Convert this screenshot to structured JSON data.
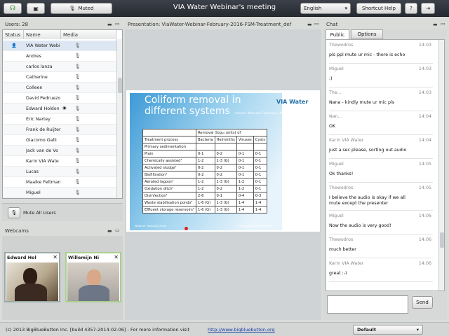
{
  "toolbar": {
    "muted_label": "Muted",
    "meeting_title": "VIA Water Webinar's meeting",
    "language": "English",
    "shortcut_label": "Shortcut Help"
  },
  "users": {
    "title": "Users: 28",
    "headers": [
      "Status",
      "Name",
      "Media"
    ],
    "rows": [
      "VIA Water Webi",
      "Andres",
      "carlos lanza",
      "Catherine",
      "Colleen",
      "David Pedruezo",
      "Edward Holdon",
      "Eric Nartey",
      "Frank de Ruijter",
      "Giacomo Galli",
      "Jack van de Vo",
      "Karin VIA Wate",
      "Lucas",
      "Maaike Feltman",
      "Miguel"
    ],
    "mute_all_label": "Mute All Users"
  },
  "presentation": {
    "title": "Presentation: ViaWater-Webinar-February-2016-FSM-Treatment_def",
    "slide_title_1": "Coliform removal in",
    "slide_title_2": "different systems",
    "slide_source": "(source: Mara and Cairncross, 1997)",
    "logo": "VIA Water",
    "table_header_top": "Removal (log₁₀ units) of",
    "table_header": [
      "Treatment process",
      "Bacteria",
      "Helminths",
      "Viruses",
      "Cysts"
    ],
    "table_rows": [
      [
        "Primary sedimentation",
        "",
        "",
        "",
        ""
      ],
      [
        "Plain",
        "0-1",
        "0-2",
        "0-1",
        "0-1"
      ],
      [
        "Chemically assisted¹",
        "1-2",
        "1-3 (G)",
        "0-1",
        "0-1"
      ],
      [
        "Activated sludge¹",
        "0-2",
        "0-2",
        "0-1",
        "0-1"
      ],
      [
        "Biofiltration¹",
        "0-2",
        "0-2",
        "0-1",
        "0-1"
      ],
      [
        "Aerated lagoon¹",
        "1-2",
        "1-3 (G)",
        "1-2",
        "0-1"
      ],
      [
        "Oxidation ditch¹",
        "1-2",
        "0-2",
        "1-2",
        "0-1"
      ],
      [
        "Disinfection¹",
        "2-6",
        "0-1",
        "0-4",
        "0-3"
      ],
      [
        "Waste stabilisation ponds³",
        "1-6 (G)",
        "1-3 (G)",
        "1-4",
        "1-4"
      ],
      [
        "Effluent storage reservoirs³",
        "1-6 (G)",
        "1-3 (G)",
        "1-4",
        "1-4"
      ]
    ],
    "slide_footer_left": "Webinar February 2016",
    "slide_footer_right": "Faecal Sludge Treatment"
  },
  "webcams": {
    "title": "Webcams",
    "cams": [
      "Edward Hol",
      "Willemijn Ni"
    ]
  },
  "chat": {
    "title": "Chat",
    "tabs": [
      "Public",
      "Options"
    ],
    "messages": [
      {
        "who": "Thewodros",
        "time": "14:03",
        "text": "pls ppl mute ur mic - there is echo"
      },
      {
        "who": "Miguel",
        "time": "14:03",
        "text": ":)"
      },
      {
        "who": "The...",
        "time": "14:03",
        "text": "Nana - kindly mute ur mic pls"
      },
      {
        "who": "Nan...",
        "time": "14:04",
        "text": "OK"
      },
      {
        "who": "Karin VIA Water",
        "time": "14:04",
        "text": "just a sec please, sorting out audio"
      },
      {
        "who": "Miguel",
        "time": "14:05",
        "text": "Ok thanks!"
      },
      {
        "who": "Thewodros",
        "time": "14:05",
        "text": "I believe the audio is okay if we all",
        "text2": "mute except the presenter"
      },
      {
        "who": "Miguel",
        "time": "14:06",
        "text": "Now the audio is very good!"
      },
      {
        "who": "Thewodros",
        "time": "14:06",
        "text": "much better"
      },
      {
        "who": "Karin VIA Water",
        "time": "14:06",
        "text": "great :-)"
      }
    ],
    "send_label": "Send"
  },
  "footer": {
    "text": "(c) 2013 BigBlueButton Inc. [build 4357-2014-02-06] - For more information visit",
    "link": "http://www.bigbluebutton.org",
    "layout": "Default"
  }
}
